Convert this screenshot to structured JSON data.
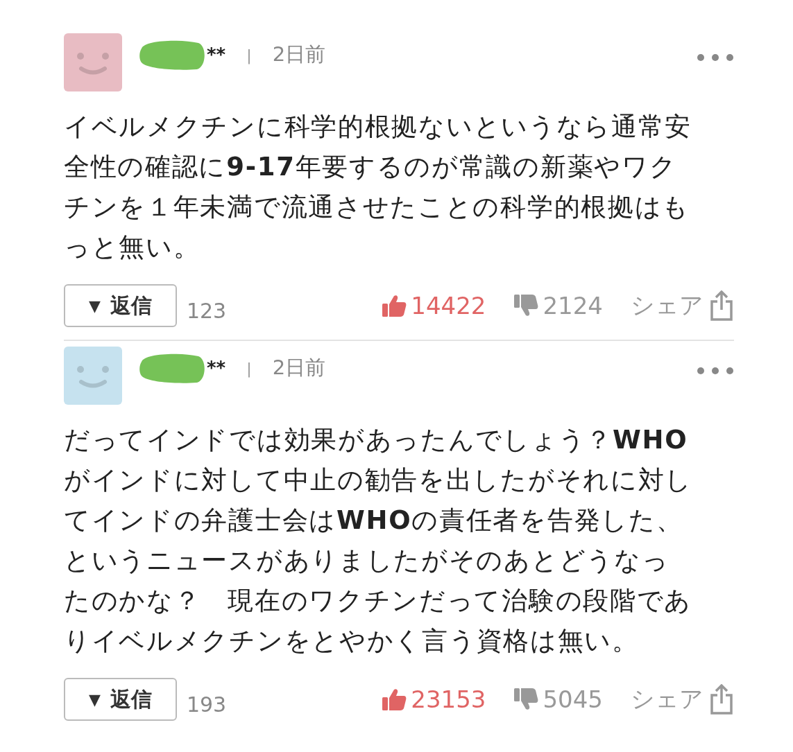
{
  "comments": [
    {
      "color": "#e8bcc3",
      "user": "**",
      "separator": "|",
      "time": "2日前",
      "body": "イベルメクチンに科学的根拠ないというなら通常安全性の確認に**9-17**年要するのが常識の新薬やワクチンを１年未満で流通させたことの科学的根拠はもっと無い。",
      "reply_arrow": "▼",
      "reply_label": "返信",
      "reply_count": "123",
      "likes": "14422",
      "dislikes": "2124",
      "share": "シェア"
    },
    {
      "color": "#c6e2ef",
      "user": "**",
      "separator": "|",
      "time": "2日前",
      "body": "だってインドでは効果があったんでしょう？**WHO**がインドに対して中止の勧告を出したがそれに対してインドの弁護士会は**WHO**の責任者を告発した、というニュースがありましたがそのあとどうなったのかな？　現在のワクチンだって治験の段階でありイベルメクチンをとやかく言う資格は無い。",
      "reply_arrow": "▼",
      "reply_label": "返信",
      "reply_count": "193",
      "likes": "23153",
      "dislikes": "5045",
      "share": "シェア"
    }
  ]
}
